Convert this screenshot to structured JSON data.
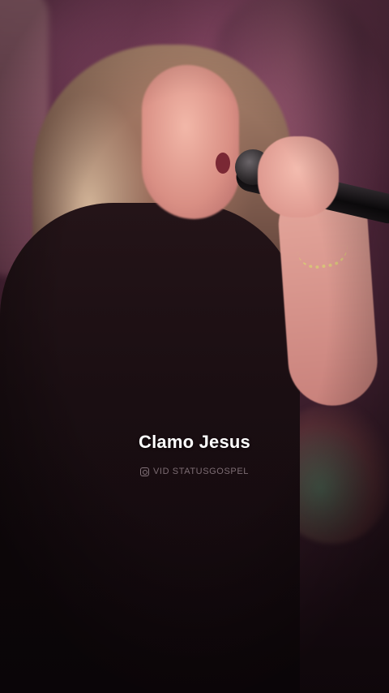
{
  "caption": {
    "text": "Clamo Jesus"
  },
  "watermark": {
    "icon": "instagram-icon",
    "text": "VID STATUSGOSPEL"
  }
}
